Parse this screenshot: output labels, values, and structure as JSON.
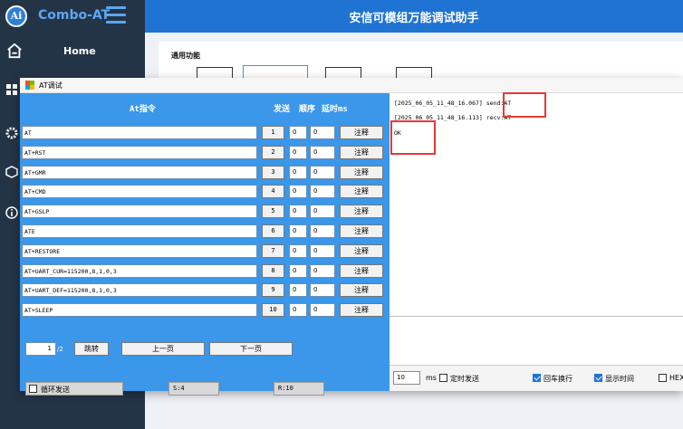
{
  "app": {
    "brand": "Combo-AT",
    "logo_text": "Ai",
    "title": "安信可模组万能调试助手",
    "nav_home": "Home",
    "section_label": "通用功能"
  },
  "dialog": {
    "title": "AT调试",
    "headers": {
      "command": "At指令",
      "send": "发送",
      "order": "顺序",
      "delay": "延时ms"
    },
    "rows": [
      {
        "cmd": "AT",
        "num": "1",
        "order": "0",
        "delay": "0",
        "note": "注释"
      },
      {
        "cmd": "AT+RST",
        "num": "2",
        "order": "0",
        "delay": "0",
        "note": "注释"
      },
      {
        "cmd": "AT+GMR",
        "num": "3",
        "order": "0",
        "delay": "0",
        "note": "注释"
      },
      {
        "cmd": "AT+CMD",
        "num": "4",
        "order": "0",
        "delay": "0",
        "note": "注释"
      },
      {
        "cmd": "AT+GSLP",
        "num": "5",
        "order": "0",
        "delay": "0",
        "note": "注释"
      },
      {
        "cmd": "ATE",
        "num": "6",
        "order": "0",
        "delay": "0",
        "note": "注释"
      },
      {
        "cmd": "AT+RESTORE",
        "num": "7",
        "order": "0",
        "delay": "0",
        "note": "注释"
      },
      {
        "cmd": "AT+UART_CUR=115200,8,1,0,3",
        "num": "8",
        "order": "0",
        "delay": "0",
        "note": "注释"
      },
      {
        "cmd": "AT+UART_DEF=115200,8,1,0,3",
        "num": "9",
        "order": "0",
        "delay": "0",
        "note": "注释"
      },
      {
        "cmd": "AT+SLEEP",
        "num": "10",
        "order": "0",
        "delay": "0",
        "note": "注释"
      }
    ],
    "pager": {
      "current": "1",
      "total": "/2",
      "jump": "跳转",
      "prev": "上一页",
      "next": "下一页"
    },
    "status": {
      "loop_send": "循环发送",
      "sent": "S:4",
      "received": "R:10"
    },
    "log": [
      "[2025_06_05_11_48_16.067] send:AT",
      "[2025_06_05_11_48_16.113] recv:AT",
      "OK"
    ],
    "options": {
      "interval": "10",
      "interval_unit": "ms",
      "timed_send": "定时发送",
      "crlf": "回车换行",
      "show_time": "显示时间",
      "hex": "HEX"
    },
    "colors": {
      "pane": "#3a97ea",
      "title_bar": "#1f74d3",
      "sidebar": "#243447",
      "highlight": "#e53935"
    }
  }
}
